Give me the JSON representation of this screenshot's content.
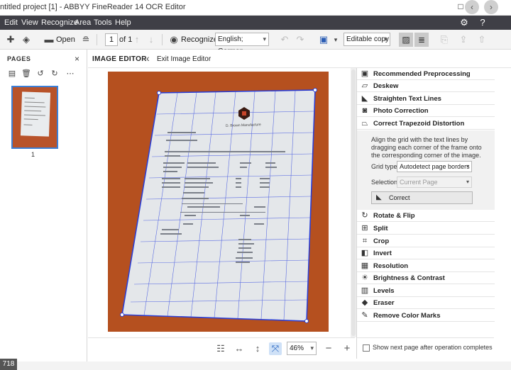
{
  "window": {
    "title": "ntitled project [1] - ABBYY FineReader 14 OCR Editor",
    "minimize": "□",
    "back": "‹",
    "forward": "›"
  },
  "menu": {
    "items": [
      "Edit",
      "View",
      "Recognize",
      "Area",
      "Tools",
      "Help"
    ]
  },
  "toolbar": {
    "open_label": "Open",
    "page_current": "1",
    "page_of": "of 1",
    "recognize_label": "Recognize",
    "language": "English; German",
    "output_mode": "Editable copy"
  },
  "pages_panel": {
    "header": "PAGES",
    "close": "×",
    "thumbnails": [
      {
        "number": "1"
      }
    ]
  },
  "editor": {
    "title": "IMAGE EDITOR",
    "exit_label": "Exit Image Editor"
  },
  "document": {
    "logo_text": "D. Brown Manufacture"
  },
  "zoom": {
    "value": "46%"
  },
  "operations": [
    {
      "label": "Recommended Preprocessing",
      "icon": "preprocess-icon"
    },
    {
      "label": "Deskew",
      "icon": "deskew-icon"
    },
    {
      "label": "Straighten Text Lines",
      "icon": "straighten-icon"
    },
    {
      "label": "Photo Correction",
      "icon": "camera-icon"
    },
    {
      "label": "Correct Trapezoid Distortion",
      "icon": "trapezoid-icon"
    },
    {
      "label": "Rotate & Flip",
      "icon": "rotate-icon"
    },
    {
      "label": "Split",
      "icon": "split-icon"
    },
    {
      "label": "Crop",
      "icon": "crop-icon"
    },
    {
      "label": "Invert",
      "icon": "invert-icon"
    },
    {
      "label": "Resolution",
      "icon": "resolution-icon"
    },
    {
      "label": "Brightness & Contrast",
      "icon": "brightness-icon"
    },
    {
      "label": "Levels",
      "icon": "levels-icon"
    },
    {
      "label": "Eraser",
      "icon": "eraser-icon"
    },
    {
      "label": "Remove Color Marks",
      "icon": "color-marks-icon"
    }
  ],
  "trapezoid": {
    "description": "Align the grid with the text lines by dragging each corner of the frame onto the corresponding corner of the image.",
    "grid_type_label": "Grid type:",
    "grid_type_value": "Autodetect page borders",
    "selection_label": "Selection:",
    "selection_value": "Current Page",
    "correct_button": "Correct"
  },
  "footer": {
    "show_next_label": "Show next page after operation completes"
  },
  "status": {
    "badge": "718"
  },
  "colors": {
    "menubar": "#3f3f46",
    "grid_frame": "#2b3fd6",
    "scan_background": "#b5501f"
  }
}
